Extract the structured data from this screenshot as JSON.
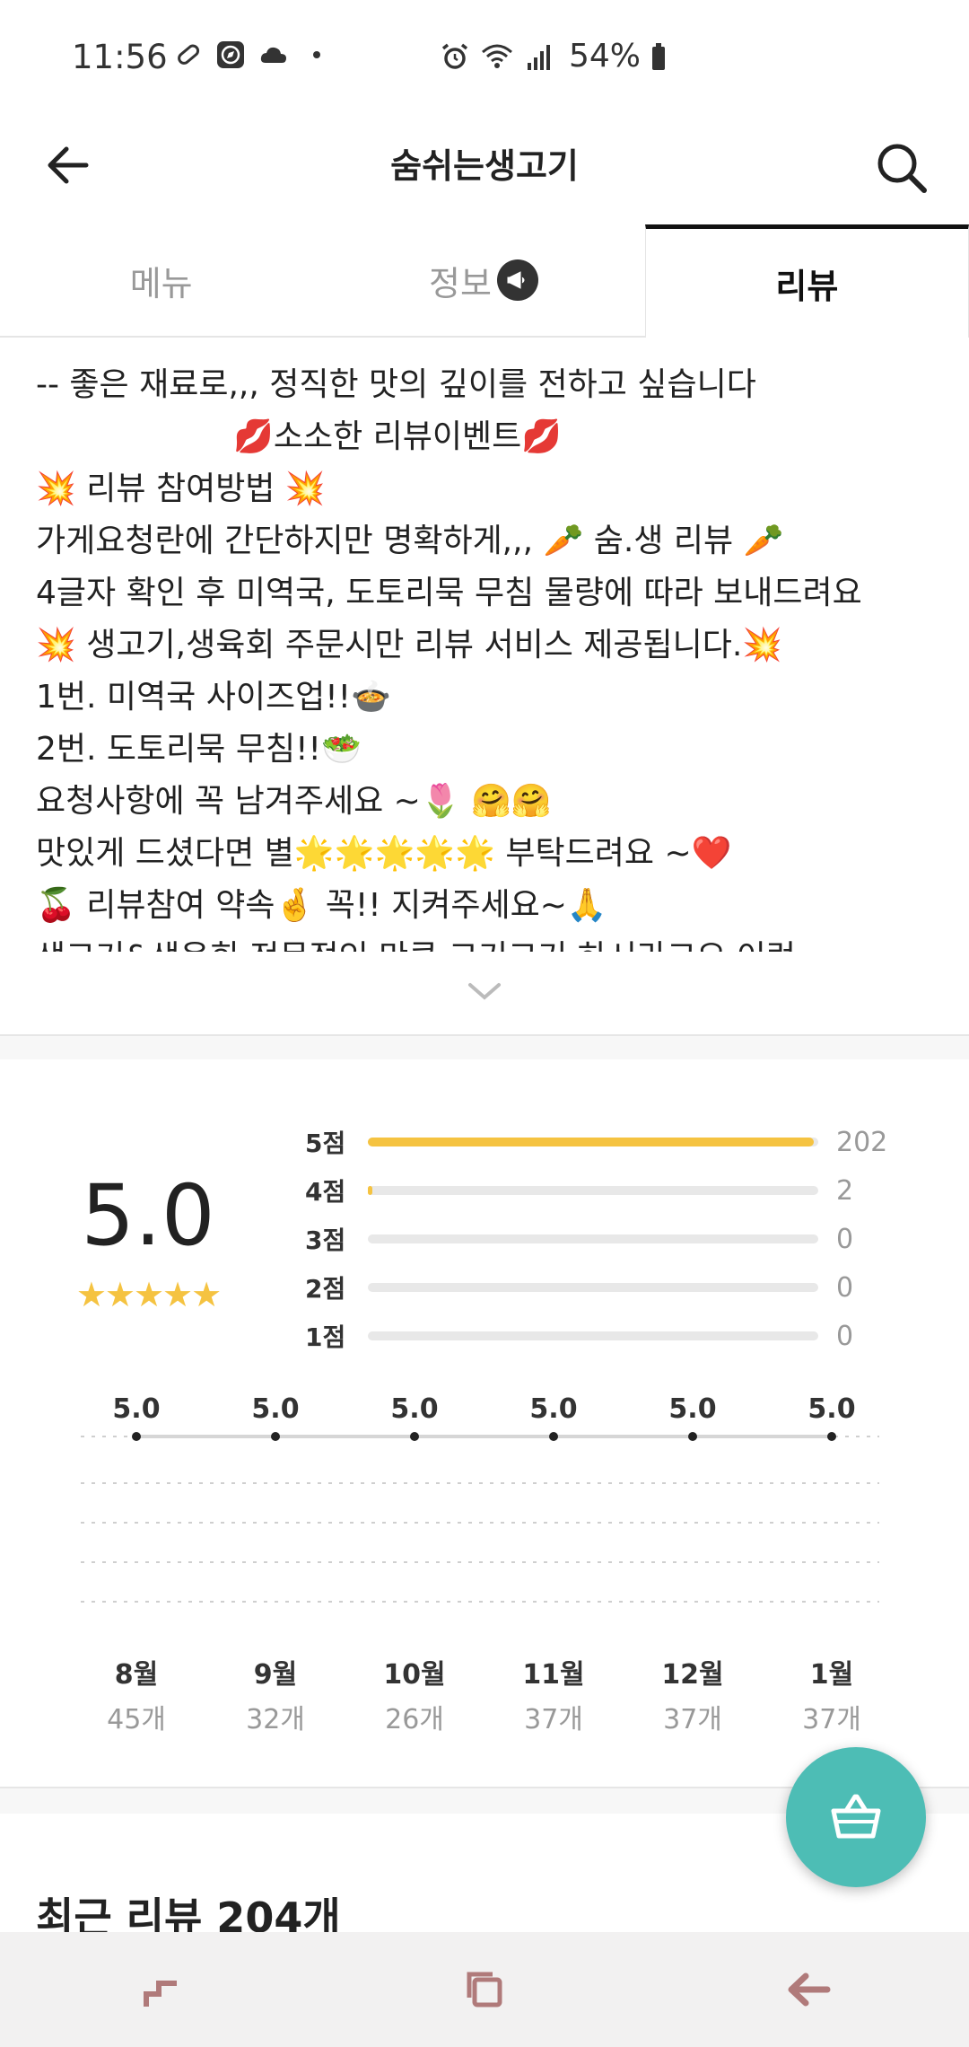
{
  "status": {
    "time": "11:56",
    "battery": "54%"
  },
  "header": {
    "title": "숨쉬는생고기"
  },
  "tabs": [
    {
      "label": "메뉴"
    },
    {
      "label": "정보"
    },
    {
      "label": "리뷰"
    }
  ],
  "notice": {
    "lines": [
      "--  좋은 재료로,,, 정직한 맛의 깊이를 전하고 싶습니다",
      "💋소소한 리뷰이벤트💋",
      "💥 리뷰 참여방법 💥",
      "가게요청란에  간단하지만 명확하게,,, 🥕  숨.생 리뷰 🥕",
      "4글자 확인 후 미역국, 도토리묵 무침 물량에 따라 보내드려요",
      "💥 생고기,생육회 주문시만 리뷰 서비스 제공됩니다.💥",
      "1번. 미역국 사이즈업!!🍲",
      "2번. 도토리묵 무침!!🥗",
      "요청사항에 꼭 남겨주세요 ~🌷 🤗🤗",
      "맛있게 드셨다면 별🌟🌟🌟🌟🌟 부탁드려요 ~❤️",
      "🍒 리뷰참여 약속🤞 꼭!! 지켜주세요~🙏",
      "생고기&생육회 전문점인 만큼 고기고기 하시라고요 이런"
    ]
  },
  "rating": {
    "average": "5.0",
    "stars": "★★★★★",
    "distribution": [
      {
        "label": "5점",
        "count": "202",
        "fraction": 0.99
      },
      {
        "label": "4점",
        "count": "2",
        "fraction": 0.01
      },
      {
        "label": "3점",
        "count": "0",
        "fraction": 0
      },
      {
        "label": "2점",
        "count": "0",
        "fraction": 0
      },
      {
        "label": "1점",
        "count": "0",
        "fraction": 0
      }
    ]
  },
  "chart_data": {
    "type": "line",
    "categories": [
      "8월",
      "9월",
      "10월",
      "11월",
      "12월",
      "1월"
    ],
    "values": [
      5.0,
      5.0,
      5.0,
      5.0,
      5.0,
      5.0
    ],
    "value_labels": [
      "5.0",
      "5.0",
      "5.0",
      "5.0",
      "5.0",
      "5.0"
    ],
    "counts": [
      "45개",
      "32개",
      "26개",
      "37개",
      "37개",
      "37개"
    ],
    "ylim": [
      0,
      5
    ],
    "grid": true
  },
  "recent": {
    "title": "최근 리뷰 204개"
  },
  "colors": {
    "star": "#f5c341",
    "fab": "#4dbdb5",
    "nav_icon": "#b07a7a"
  },
  "icons": {
    "back": "arrow-left-icon",
    "search": "search-icon",
    "cart": "basket-icon",
    "expand": "chevron-down-icon"
  }
}
